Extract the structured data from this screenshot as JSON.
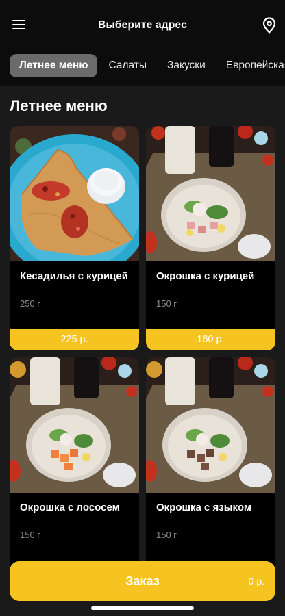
{
  "header": {
    "address_label": "Выберите адрес",
    "menu_icon": "hamburger-menu-icon",
    "location_icon": "map-pin-icon"
  },
  "tabs": [
    {
      "label": "Летнее меню",
      "active": true
    },
    {
      "label": "Салаты",
      "active": false
    },
    {
      "label": "Закуски",
      "active": false
    },
    {
      "label": "Европейская",
      "active": false
    }
  ],
  "section": {
    "title": "Летнее меню"
  },
  "products": [
    {
      "name": "Кесадилья с курицей",
      "weight": "250 г",
      "price": "225 р."
    },
    {
      "name": "Окрошка с курицей",
      "weight": "150 г",
      "price": "160 р."
    },
    {
      "name": "Окрошка с лососем",
      "weight": "150 г",
      "price": ""
    },
    {
      "name": "Окрошка с языком",
      "weight": "150 г",
      "price": ""
    }
  ],
  "order": {
    "label": "Заказ",
    "total": "0 р."
  },
  "colors": {
    "accent": "#f6c420",
    "background": "#0c0c0c",
    "tab_active": "#6b6b6b"
  }
}
